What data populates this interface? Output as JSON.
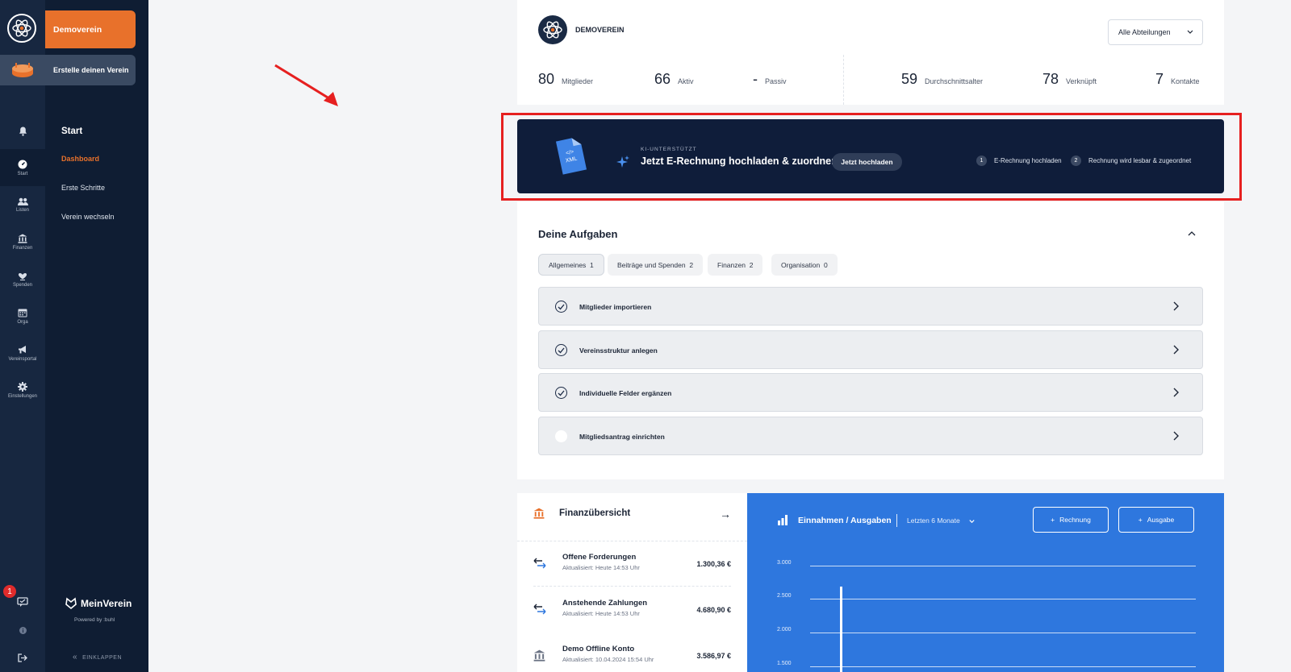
{
  "sidebar": {
    "club_name": "Demoverein",
    "create_club": "Erstelle deinen Verein",
    "section_title": "Start",
    "links": [
      "Dashboard",
      "Erste Schritte",
      "Verein wechseln"
    ],
    "brand": "MeinVerein",
    "powered_by": "Powered by :buhl",
    "collapse_label": "EINKLAPPEN"
  },
  "rail": {
    "items": [
      {
        "label": "Start",
        "icon": "speedometer-icon"
      },
      {
        "label": "Listen",
        "icon": "people-icon"
      },
      {
        "label": "Finanzen",
        "icon": "bank-icon"
      },
      {
        "label": "Spenden",
        "icon": "donate-icon"
      },
      {
        "label": "Orga",
        "icon": "calendar-icon"
      },
      {
        "label": "Vereinsportal",
        "icon": "megaphone-icon"
      },
      {
        "label": "Einstellungen",
        "icon": "gear-icon"
      }
    ],
    "notification_count": "1"
  },
  "header": {
    "org_name": "DEMOVEREIN",
    "department_select": "Alle Abteilungen"
  },
  "stats": [
    {
      "value": "80",
      "label": "Mitglieder"
    },
    {
      "value": "66",
      "label": "Aktiv"
    },
    {
      "value": "-",
      "label": "Passiv"
    },
    {
      "value": "59",
      "label": "Durchschnittsalter"
    },
    {
      "value": "78",
      "label": "Verknüpft"
    },
    {
      "value": "7",
      "label": "Kontakte"
    }
  ],
  "banner": {
    "eyebrow": "KI-UNTERSTÜTZT",
    "title": "Jetzt E-Rechnung hochladen & zuordnen",
    "button": "Jetzt hochladen",
    "steps": [
      {
        "num": "1",
        "label": "E-Rechnung hochladen"
      },
      {
        "num": "2",
        "label": "Rechnung wird lesbar & zugeordnet"
      }
    ],
    "file_label": "XML",
    "highlight_color": "#e62020"
  },
  "tasks": {
    "title": "Deine Aufgaben",
    "filters": [
      {
        "label": "Allgemeines",
        "count": "1"
      },
      {
        "label": "Beiträge und Spenden",
        "count": "2"
      },
      {
        "label": "Finanzen",
        "count": "2"
      },
      {
        "label": "Organisation",
        "count": "0"
      }
    ],
    "items": [
      {
        "label": "Mitglieder importieren",
        "done": true
      },
      {
        "label": "Vereinsstruktur anlegen",
        "done": true
      },
      {
        "label": "Individuelle Felder ergänzen",
        "done": true
      },
      {
        "label": "Mitgliedsantrag einrichten",
        "done": false
      }
    ]
  },
  "finance": {
    "title": "Finanzübersicht",
    "rows": [
      {
        "title": "Offene Forderungen",
        "sub": "Aktualisiert: Heute 14:53 Uhr",
        "value": "1.300,36 €"
      },
      {
        "title": "Anstehende Zahlungen",
        "sub": "Aktualisiert: Heute 14:53 Uhr",
        "value": "4.680,90 €"
      },
      {
        "title": "Demo Offline Konto",
        "sub": "Aktualisiert: 10.04.2024 15:54 Uhr",
        "value": "3.586,97 €"
      }
    ]
  },
  "chart": {
    "title": "Einnahmen / Ausgaben",
    "range": "Letzten 6 Monate",
    "btn_invoice": "Rechnung",
    "btn_expense": "Ausgabe",
    "y_ticks": [
      "3.000",
      "2.500",
      "2.000",
      "1.500"
    ]
  },
  "colors": {
    "accent": "#e8712b",
    "nav_dark": "#0f1d33",
    "chart_blue": "#2e77de"
  }
}
